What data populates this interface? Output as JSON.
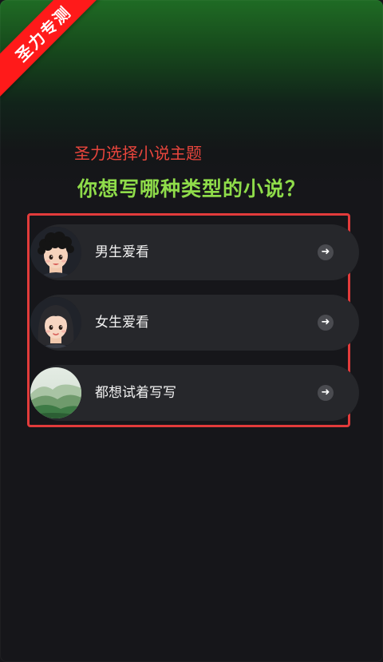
{
  "ribbon": {
    "text": "圣力专测",
    "color": "#ff1a1a"
  },
  "header": {
    "subtitle": "圣力选择小说主题",
    "title": "你想写哪种类型的小说？",
    "subtitle_color": "#e8453c",
    "title_color": "#8fdc4a"
  },
  "options": [
    {
      "label": "男生爱看",
      "avatar": "boy-avatar",
      "action_icon": "arrow-right-icon"
    },
    {
      "label": "女生爱看",
      "avatar": "girl-avatar",
      "action_icon": "arrow-right-icon"
    },
    {
      "label": "都想试着写写",
      "avatar": "landscape-avatar",
      "action_icon": "arrow-right-icon"
    }
  ],
  "arrow_glyph": "➜",
  "highlight_color": "#e23b3b"
}
